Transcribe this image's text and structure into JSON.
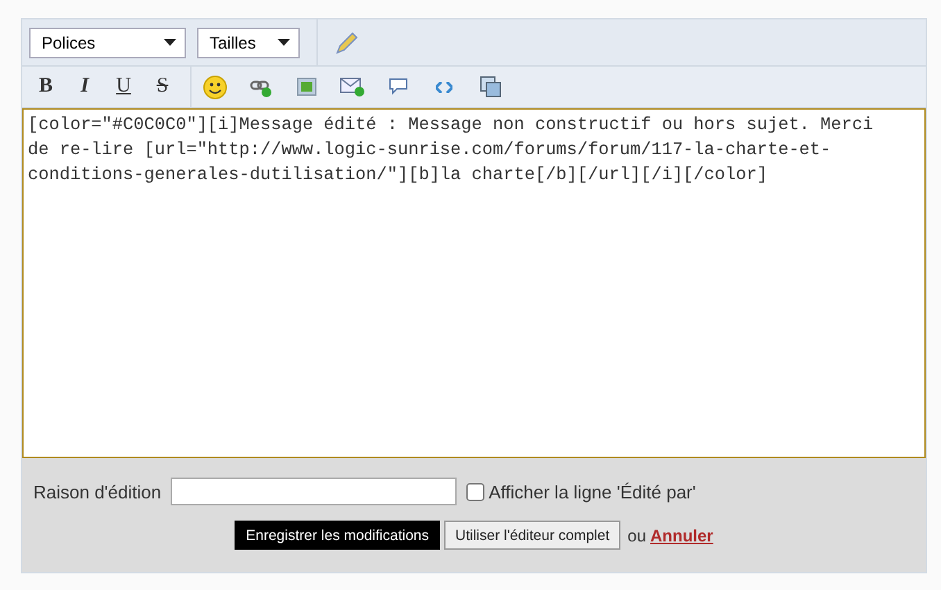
{
  "toolbar": {
    "font_select": "Polices",
    "size_select": "Tailles",
    "format_buttons": [
      {
        "kind": "bold",
        "label": "B"
      },
      {
        "kind": "italic",
        "label": "I"
      },
      {
        "kind": "underline",
        "label": "U"
      },
      {
        "kind": "strike",
        "label": "S"
      }
    ],
    "insert_buttons": [
      {
        "kind": "smiley"
      },
      {
        "kind": "link"
      },
      {
        "kind": "image"
      },
      {
        "kind": "email"
      },
      {
        "kind": "quote"
      },
      {
        "kind": "code"
      },
      {
        "kind": "copy"
      }
    ]
  },
  "editor": {
    "lines": [
      "[color=\"#C0C0C0\"][i]Message édité : Message non constructif ou hors sujet. Merci",
      "de re-lire [url=\"http://www.logic-sunrise.com/forums/forum/117-la-charte-et-",
      "conditions-generales-dutilisation/\"][b]la charte[/b][/url][/i][/color]"
    ]
  },
  "edit_reason": {
    "label": "Raison d'édition",
    "checkbox_label": "Afficher la ligne 'Édité par'",
    "checked": false
  },
  "buttons": {
    "save": "Enregistrer les modifications",
    "full_editor": "Utiliser l'éditeur complet",
    "or": "ou",
    "cancel": "Annuler"
  }
}
